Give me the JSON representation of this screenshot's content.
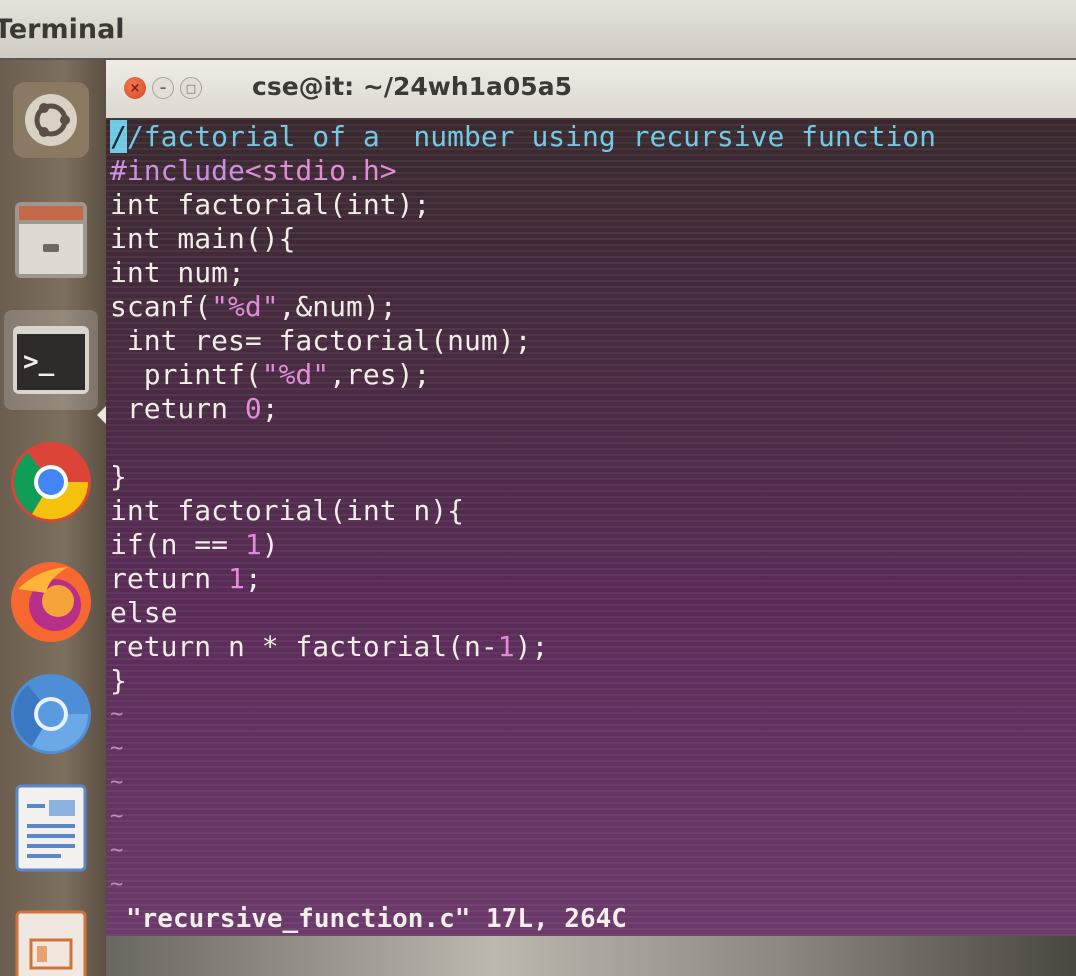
{
  "top_panel": {
    "app_name": "Terminal"
  },
  "launcher": {
    "items": [
      {
        "name": "ubuntu-dash",
        "icon": "ubuntu-logo-icon"
      },
      {
        "name": "files",
        "icon": "file-cabinet-icon"
      },
      {
        "name": "terminal",
        "icon": "terminal-icon",
        "active": true
      },
      {
        "name": "chrome",
        "icon": "chrome-icon"
      },
      {
        "name": "firefox",
        "icon": "firefox-icon"
      },
      {
        "name": "chromium",
        "icon": "chromium-icon"
      },
      {
        "name": "libreoffice-writer",
        "icon": "writer-document-icon"
      },
      {
        "name": "libreoffice-impress",
        "icon": "impress-presentation-icon"
      }
    ]
  },
  "window": {
    "title": "cse@it: ~/24wh1a05a5",
    "buttons": {
      "close": "×",
      "minimize": "–",
      "maximize": "□"
    }
  },
  "editor": {
    "cursor_char": "/",
    "comment_rest": "/factorial of a  number using recursive function",
    "include_kw": "#include",
    "include_arg": "<stdio.h>",
    "line3": "int factorial(int);",
    "line4": "int main(){",
    "line5": "int num;",
    "scanf_pre": "scanf(",
    "scanf_str": "\"%d\"",
    "scanf_post": ",&num);",
    "line7": " int res= factorial(num);",
    "printf_pre": "  printf(",
    "printf_str": "\"%d\"",
    "printf_post": ",res);",
    "return_pre": " return ",
    "return_num": "0",
    "return_post": ";",
    "close_brace": "}",
    "line12": "int factorial(int n){",
    "if_pre": "if(n == ",
    "if_num": "1",
    "if_post": ")",
    "ret1_pre": "return ",
    "ret1_num": "1",
    "ret1_post": ";",
    "else": "else",
    "recur_pre": "return n * factorial(n-",
    "recur_num": "1",
    "recur_post": ");",
    "close_brace2": "}",
    "tilde": "~",
    "status": "\"recursive_function.c\" 17L, 264C"
  },
  "colors": {
    "comment": "#6fc9e4",
    "preproc": "#c98de0",
    "string": "#e08ad6",
    "text": "#f0ece6",
    "background": "#5a2c58"
  }
}
